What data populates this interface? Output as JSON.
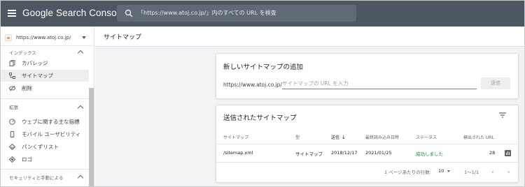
{
  "app": {
    "brand": "Google Search Console",
    "search_placeholder": "「https://www.atoj.co.jp/」内のすべての URL を検査"
  },
  "sidebar": {
    "property": "https://www.atoj.co.jp/",
    "index_section": "インデックス",
    "index_items": [
      {
        "label": "カバレッジ",
        "icon": "coverage-icon"
      },
      {
        "label": "サイトマップ",
        "icon": "sitemap-icon",
        "active": true
      },
      {
        "label": "削除",
        "icon": "removal-icon"
      }
    ],
    "enhance_section": "拡張",
    "enhance_items": [
      {
        "label": "ウェブに関する主な指標",
        "icon": "speed-icon"
      },
      {
        "label": "モバイル ユーザビリティ",
        "icon": "mobile-icon"
      },
      {
        "label": "パンくずリスト",
        "icon": "breadcrumb-icon"
      },
      {
        "label": "ロゴ",
        "icon": "logo-icon"
      }
    ],
    "security_section": "セキュリティと手動による"
  },
  "main": {
    "page_title": "サイトマップ",
    "add_card": {
      "title": "新しいサイトマップの追加",
      "url_prefix": "https://www.atoj.co.jp/",
      "input_placeholder": "サイトマップの URL を入力",
      "submit_label": "送信"
    },
    "submitted_card": {
      "title": "送信されたサイトマップ",
      "columns": [
        "サイトマップ",
        "型",
        "送信",
        "最終読み込み日時",
        "ステータス",
        "検出された URL"
      ],
      "rows": [
        {
          "sitemap": "/sitemap.xml",
          "type": "サイトマップ",
          "submitted": "2018/12/17",
          "last_read": "2021/01/25",
          "status": "成功しました",
          "urls": "28"
        }
      ],
      "pagination": {
        "rows_per_page_label": "1 ページあたりの行数:",
        "rows_per_page": "10",
        "range": "1〜1/1"
      }
    }
  },
  "colors": {
    "topbar": "#4d5761",
    "accent": "#4285f4",
    "success": "#188038"
  }
}
